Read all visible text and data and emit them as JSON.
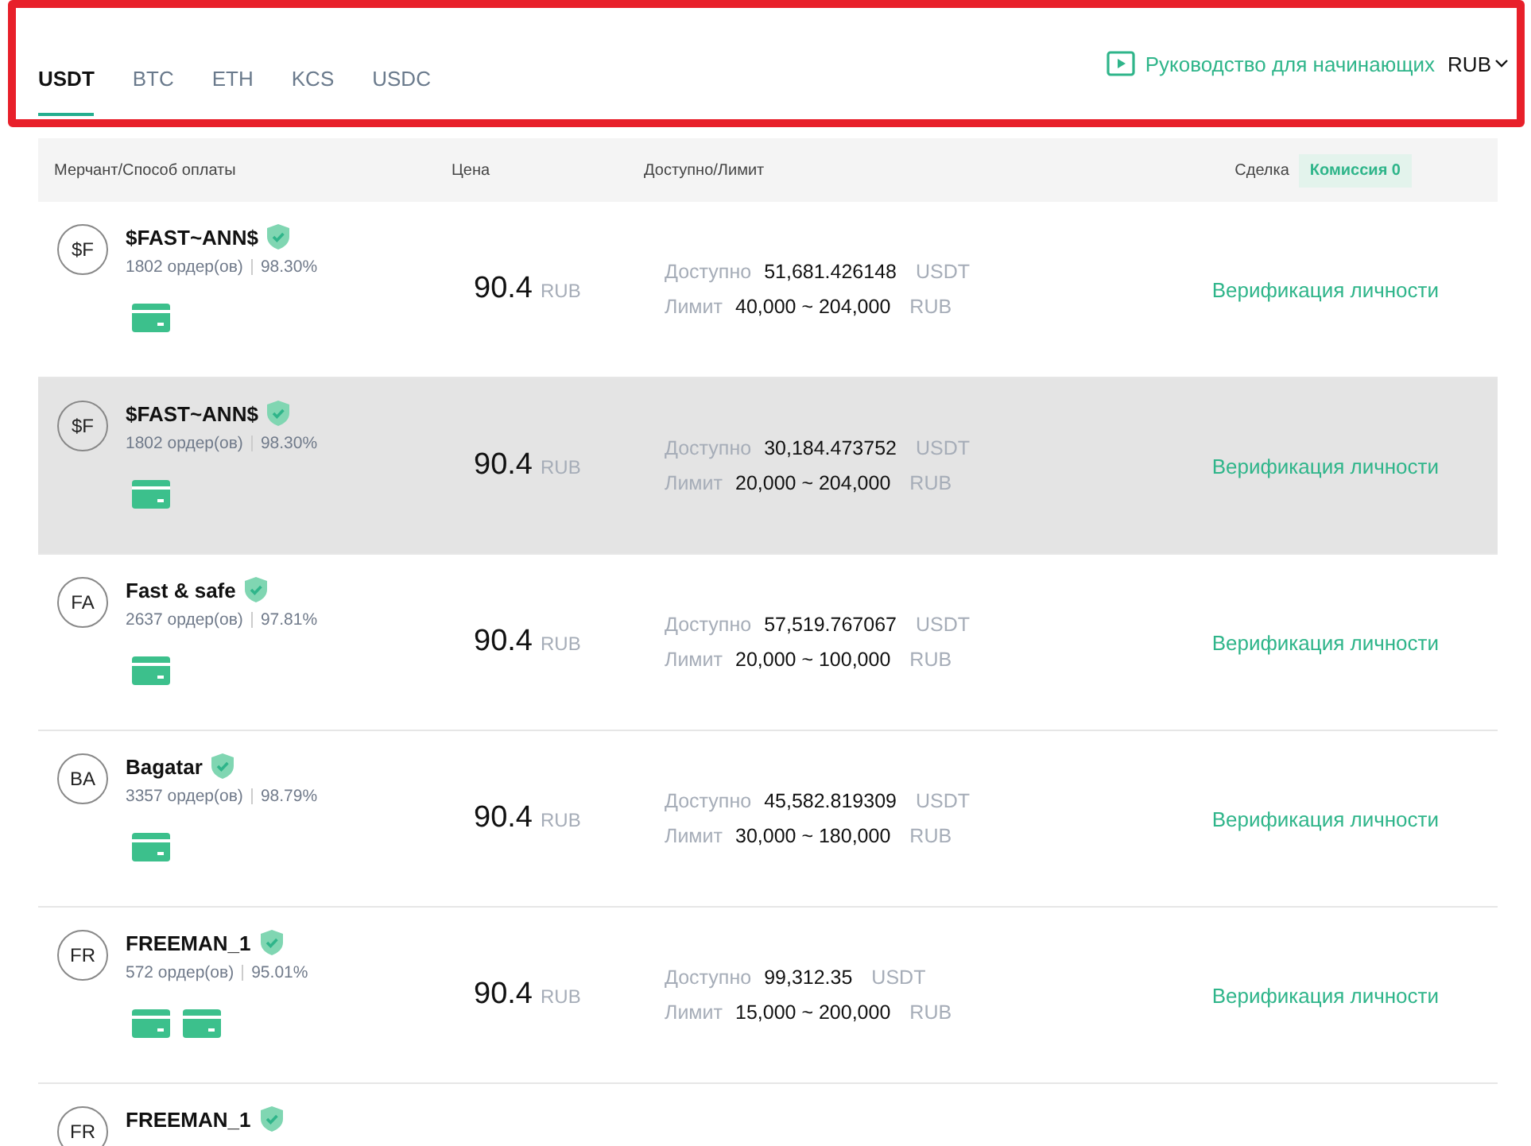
{
  "tabs": [
    {
      "label": "USDT",
      "selected": true
    },
    {
      "label": "BTC",
      "selected": false
    },
    {
      "label": "ETH",
      "selected": false
    },
    {
      "label": "KCS",
      "selected": false
    },
    {
      "label": "USDC",
      "selected": false
    }
  ],
  "guide_link": "Руководство для начинающих",
  "currency": "RUB",
  "annotation_frame": true,
  "table": {
    "columns": [
      "Мерчант/Способ оплаты",
      "Цена",
      "Доступно/Лимит",
      "Сделка"
    ],
    "fee_badge": "Комиссия 0",
    "rows": [
      {
        "avatar": "$F",
        "name": "$FAST~ANN$",
        "verified": true,
        "orders": "1802 ордер(ов)",
        "rate": "98.30%",
        "payment_methods": [
          {
            "kind": "card"
          }
        ],
        "price": "90.4",
        "price_currency": "RUB",
        "available_label": "Доступно",
        "available": "51,681.426148",
        "available_currency": "USDT",
        "limit_label": "Лимит",
        "limit": "40,000 ~ 204,000",
        "limit_currency": "RUB",
        "action": "Верификация личности",
        "highlighted": false
      },
      {
        "avatar": "$F",
        "name": "$FAST~ANN$",
        "verified": true,
        "orders": "1802 ордер(ов)",
        "rate": "98.30%",
        "payment_methods": [
          {
            "kind": "card"
          }
        ],
        "price": "90.4",
        "price_currency": "RUB",
        "available_label": "Доступно",
        "available": "30,184.473752",
        "available_currency": "USDT",
        "limit_label": "Лимит",
        "limit": "20,000 ~ 204,000",
        "limit_currency": "RUB",
        "action": "Верификация личности",
        "highlighted": true
      },
      {
        "avatar": "FA",
        "name": "Fast & safe",
        "verified": true,
        "orders": "2637 ордер(ов)",
        "rate": "97.81%",
        "payment_methods": [
          {
            "kind": "card"
          }
        ],
        "price": "90.4",
        "price_currency": "RUB",
        "available_label": "Доступно",
        "available": "57,519.767067",
        "available_currency": "USDT",
        "limit_label": "Лимит",
        "limit": "20,000 ~ 100,000",
        "limit_currency": "RUB",
        "action": "Верификация личности",
        "highlighted": false
      },
      {
        "avatar": "BA",
        "name": "Bagatar",
        "verified": true,
        "orders": "3357 ордер(ов)",
        "rate": "98.79%",
        "payment_methods": [
          {
            "kind": "card"
          }
        ],
        "price": "90.4",
        "price_currency": "RUB",
        "available_label": "Доступно",
        "available": "45,582.819309",
        "available_currency": "USDT",
        "limit_label": "Лимит",
        "limit": "30,000 ~ 180,000",
        "limit_currency": "RUB",
        "action": "Верификация личности",
        "highlighted": false
      },
      {
        "avatar": "FR",
        "name": "FREEMAN_1",
        "verified": true,
        "orders": "572 ордер(ов)",
        "rate": "95.01%",
        "payment_methods": [
          {
            "kind": "card"
          },
          {
            "kind": "card"
          }
        ],
        "price": "90.4",
        "price_currency": "RUB",
        "available_label": "Доступно",
        "available": "99,312.35",
        "available_currency": "USDT",
        "limit_label": "Лимит",
        "limit": "15,000 ~ 200,000",
        "limit_currency": "RUB",
        "action": "Верификация личности",
        "highlighted": false
      },
      {
        "avatar": "FR",
        "name": "FREEMAN_1",
        "verified": true,
        "highlighted": false
      }
    ]
  }
}
